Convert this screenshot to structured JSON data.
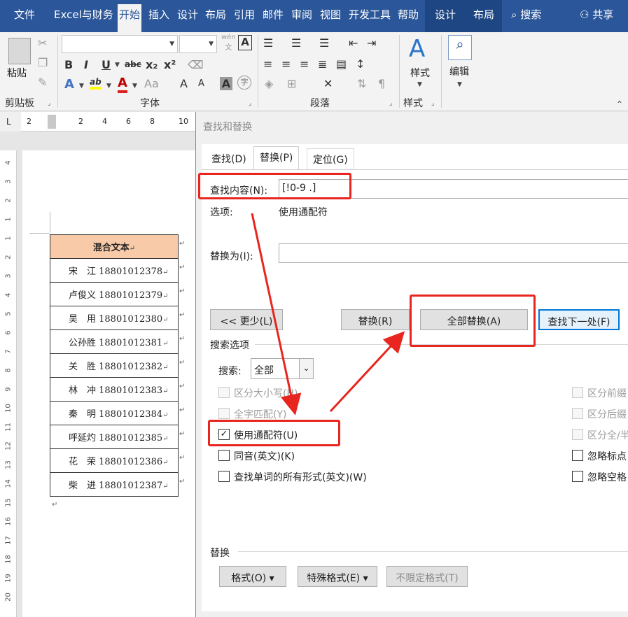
{
  "tabs": [
    "文件",
    "Excel与财务",
    "开始",
    "插入",
    "设计",
    "布局",
    "引用",
    "邮件",
    "审阅",
    "视图",
    "开发工具",
    "帮助",
    "设计",
    "布局"
  ],
  "tab_search": "搜索",
  "tab_share": "共享",
  "ribbon": {
    "paste_label": "粘贴",
    "clipboard_label": "剪贴板",
    "font_label": "字体",
    "paragraph_label": "段落",
    "styles_btn": "样式",
    "styles_label": "样式",
    "edit_btn": "编辑",
    "wen_icon": "wén",
    "wen_char": "文",
    "font_buttons": [
      "B",
      "I",
      "U",
      "abc",
      "x₂",
      "x²"
    ],
    "font_row3": [
      "A",
      "A",
      "Aa",
      "A",
      "字"
    ],
    "highlight_label": "ab"
  },
  "ruler": {
    "corner": "L",
    "marks": [
      "2",
      "2",
      "4",
      "6",
      "8",
      "10"
    ],
    "vertical": [
      "4",
      "3",
      "2",
      "1",
      "1",
      "2",
      "3",
      "4",
      "5",
      "6",
      "7",
      "8",
      "9",
      "10",
      "11",
      "12",
      "13",
      "14",
      "15",
      "16",
      "17",
      "18",
      "19",
      "20"
    ]
  },
  "doc": {
    "header": "混合文本",
    "para_mark": "↵",
    "rows": [
      "宋　江 18801012378",
      "卢俊义 18801012379",
      "吴　用 18801012380",
      "公孙胜 18801012381",
      "关　胜 18801012382",
      "林　冲 18801012383",
      "秦　明 18801012384",
      "呼延灼 18801012385",
      "花　荣 18801012386",
      "柴　进 18801012387"
    ]
  },
  "dialog": {
    "title": "查找和替换",
    "tabs": [
      "查找(D)",
      "替换(P)",
      "定位(G)"
    ],
    "find_label": "查找内容(N):",
    "find_value": "[!0-9 .]",
    "options_label": "选项:",
    "options_value": "使用通配符",
    "replace_label": "替换为(I):",
    "replace_value": "",
    "less_btn": "<< 更少(L)",
    "replace_btn": "替换(R)",
    "replace_all_btn": "全部替换(A)",
    "find_next_btn": "查找下一处(F)",
    "search_options": "搜索选项",
    "search_label": "搜索:",
    "search_value": "全部",
    "checks": [
      {
        "label": "区分大小写(H)",
        "checked": false,
        "disabled": true
      },
      {
        "label": "全字匹配(Y)",
        "checked": false,
        "disabled": true
      },
      {
        "label": "使用通配符(U)",
        "checked": true,
        "disabled": false
      },
      {
        "label": "同音(英文)(K)",
        "checked": false,
        "disabled": false
      },
      {
        "label": "查找单词的所有形式(英文)(W)",
        "checked": false,
        "disabled": false
      }
    ],
    "checks_right": [
      {
        "label": "区分前缀",
        "checked": false,
        "disabled": true
      },
      {
        "label": "区分后缀",
        "checked": false,
        "disabled": true
      },
      {
        "label": "区分全/半",
        "checked": false,
        "disabled": true
      },
      {
        "label": "忽略标点",
        "checked": false,
        "disabled": false
      },
      {
        "label": "忽略空格",
        "checked": false,
        "disabled": false
      }
    ],
    "replace_section": "替换",
    "format_btn": "格式(O) ▾",
    "special_btn": "特殊格式(E) ▾",
    "noformat_btn": "不限定格式(T)"
  },
  "colors": {
    "accent": "#2b579a",
    "annotation": "#e8251f",
    "header_fill": "#f8caa8"
  }
}
